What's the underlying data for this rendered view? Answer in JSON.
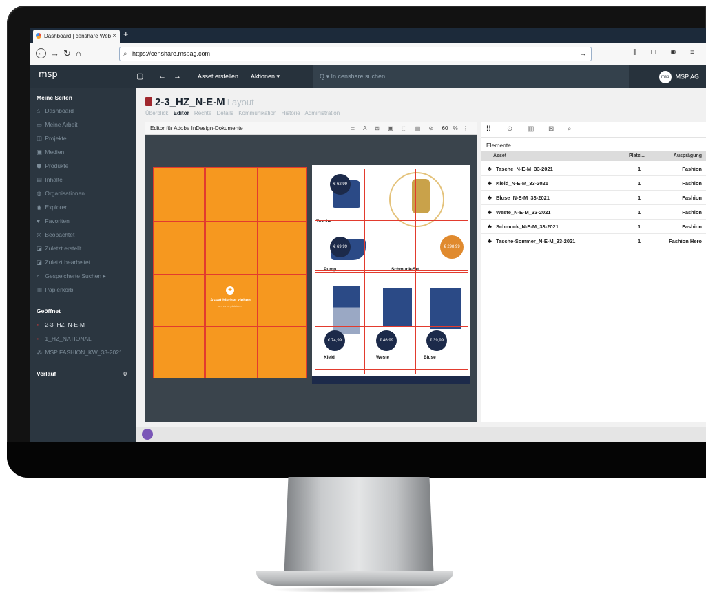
{
  "browser": {
    "tab_title": "Dashboard | censhare Web",
    "tab_close": "×",
    "new_tab": "+",
    "url": "https://censhare.mspag.com",
    "nav": {
      "back": "←",
      "forward": "→",
      "reload": "↻",
      "home": "⌂",
      "go": "→"
    },
    "toolbar_icons": "⫼ ▢ ◉ ≡"
  },
  "app": {
    "logo": "msp",
    "sidebar_toggle": "▢",
    "back": "←",
    "forward": "→",
    "create_asset": "Asset erstellen",
    "actions": "Aktionen ▾",
    "search_placeholder": "Q ▾  In censhare suchen",
    "org_name": "MSP AG",
    "org_avatar": "msp"
  },
  "sidebar": {
    "my_pages_heading": "Meine Seiten",
    "items": [
      {
        "icon": "⌂",
        "label": "Dashboard"
      },
      {
        "icon": "▭",
        "label": "Meine Arbeit"
      },
      {
        "icon": "◫",
        "label": "Projekte"
      },
      {
        "icon": "▣",
        "label": "Medien"
      },
      {
        "icon": "⬢",
        "label": "Produkte"
      },
      {
        "icon": "▤",
        "label": "Inhalte"
      },
      {
        "icon": "◍",
        "label": "Organisationen"
      },
      {
        "icon": "◉",
        "label": "Explorer"
      },
      {
        "icon": "♥",
        "label": "Favoriten"
      },
      {
        "icon": "◎",
        "label": "Beobachtet"
      },
      {
        "icon": "◪",
        "label": "Zuletzt erstellt"
      },
      {
        "icon": "◪",
        "label": "Zuletzt bearbeitet"
      },
      {
        "icon": "⌕",
        "label": "Gespeicherte Suchen ▸"
      },
      {
        "icon": "▥",
        "label": "Papierkorb"
      }
    ],
    "open_heading": "Geöffnet",
    "open_items": [
      "2-3_HZ_N-E-M",
      "1_HZ_NATIONAL",
      "MSP FASHION_KW_33-2021"
    ],
    "history_heading": "Verlauf",
    "history_count": "0"
  },
  "document": {
    "title": "2-3_HZ_N-E-M",
    "type": "Layout",
    "tabs": [
      "Überblick",
      "Editor",
      "Rechte",
      "Details",
      "Kommunikation",
      "Historie",
      "Administration"
    ],
    "active_tab": "Editor"
  },
  "editor": {
    "title": "Editor für Adobe InDesign-Dokumente",
    "tool_icons": "≣ A ⊠ ▣ ⬚ ▤ ⊘",
    "zoom": "60",
    "zoom_unit": "%",
    "drop_label": "Asset hierher ziehen",
    "drop_sub": "um es zu platzieren"
  },
  "layout_products": [
    {
      "name": "Tasche",
      "price": "€ 62,99"
    },
    {
      "name": "Pump",
      "price": "€ 69,99"
    },
    {
      "name": "Schmuck-Set",
      "price": "€ 298,99"
    },
    {
      "name": "Kleid",
      "price": "€ 74,99"
    },
    {
      "name": "Weste",
      "price": "€ 46,99"
    },
    {
      "name": "Bluse",
      "price": "€ 39,99"
    }
  ],
  "panel": {
    "tab_icons": [
      "⁞⁞",
      "⊙",
      "▥",
      "⊠",
      "⌕"
    ],
    "heading": "Elemente",
    "columns": [
      "Asset",
      "Platzi...",
      "Ausprägung"
    ],
    "rows": [
      {
        "asset": "Tasche_N-E-M_33-2021",
        "placement": "1",
        "variant": "Fashion"
      },
      {
        "asset": "Kleid_N-E-M_33-2021",
        "placement": "1",
        "variant": "Fashion"
      },
      {
        "asset": "Bluse_N-E-M_33-2021",
        "placement": "1",
        "variant": "Fashion"
      },
      {
        "asset": "Weste_N-E-M_33-2021",
        "placement": "1",
        "variant": "Fashion"
      },
      {
        "asset": "Schmuck_N-E-M_33-2021",
        "placement": "1",
        "variant": "Fashion"
      },
      {
        "asset": "Tasche-Sommer_N-E-M_33-2021",
        "placement": "1",
        "variant": "Fashion Hero"
      }
    ]
  },
  "colors": {
    "accent_orange": "#f6981f",
    "grid_red": "#e23b2e",
    "sidebar_bg": "#2b3640",
    "header_bg": "#27323c",
    "price_navy": "#1c2a4a",
    "price_gold": "#e08a2e"
  }
}
